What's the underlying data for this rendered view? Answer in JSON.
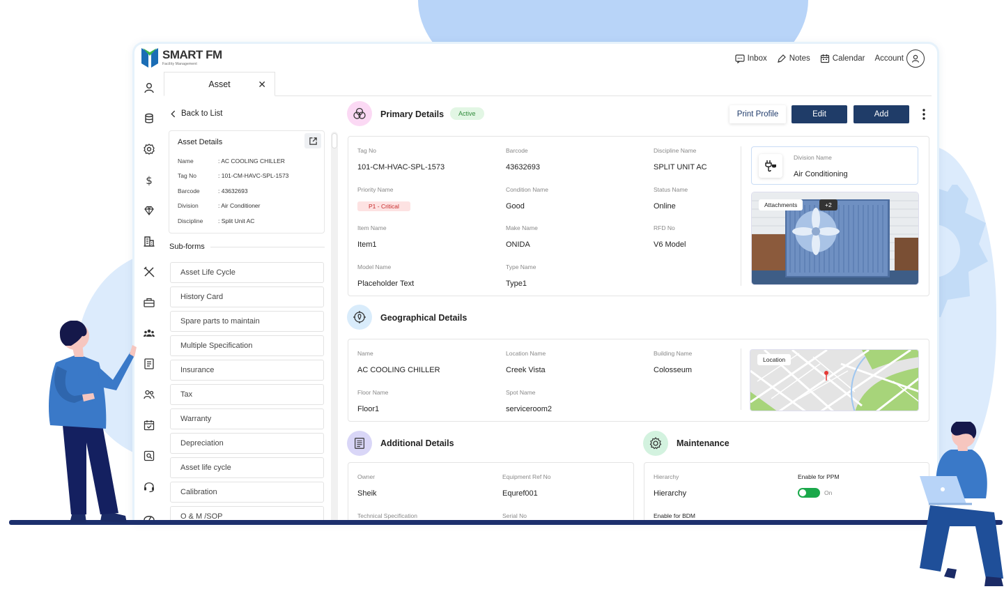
{
  "brand": {
    "name": "SMART FM",
    "tagline": "Facility Management"
  },
  "topnav": {
    "inbox": "Inbox",
    "notes": "Notes",
    "calendar": "Calendar",
    "account": "Account"
  },
  "tab": {
    "label": "Asset",
    "close": "✕"
  },
  "back": "Back to List",
  "asset_details": {
    "title": "Asset Details",
    "rows": [
      {
        "key": "Name",
        "value": ": AC COOLING CHILLER"
      },
      {
        "key": "Tag No",
        "value": ": 101-CM-HAVC-SPL-1573"
      },
      {
        "key": "Barcode",
        "value": ": 43632693"
      },
      {
        "key": "Division",
        "value": ": Air Conditioner"
      },
      {
        "key": "Discipline",
        "value": ": Split Unit AC"
      }
    ]
  },
  "subforms": {
    "title": "Sub-forms",
    "items": [
      "Asset Life Cycle",
      "History Card",
      "Spare parts to maintain",
      "Multiple Specification",
      "Insurance",
      "Tax",
      "Warranty",
      "Depreciation",
      "Asset life cycle",
      "Calibration",
      "O & M /SOP"
    ]
  },
  "primary": {
    "title": "Primary Details",
    "status": "Active",
    "buttons": {
      "print": "Print Profile",
      "edit": "Edit",
      "add": "Add"
    },
    "fields": {
      "tag_no": {
        "label": "Tag No",
        "value": "101-CM-HVAC-SPL-1573"
      },
      "barcode": {
        "label": "Barcode",
        "value": "43632693"
      },
      "discipline": {
        "label": "Discipline Name",
        "value": "SPLIT UNIT AC"
      },
      "priority": {
        "label": "Priority Name",
        "value": "P1 - Critical"
      },
      "condition": {
        "label": "Condition Name",
        "value": "Good"
      },
      "status": {
        "label": "Status Name",
        "value": "Online"
      },
      "item": {
        "label": "Item Name",
        "value": "Item1"
      },
      "make": {
        "label": "Make Name",
        "value": "ONIDA"
      },
      "rfd": {
        "label": "RFD No",
        "value": "V6 Model"
      },
      "model": {
        "label": "Model Name",
        "value": "Placeholder Text"
      },
      "type": {
        "label": "Type Name",
        "value": "Type1"
      }
    },
    "division": {
      "label": "Division Name",
      "value": "Air Conditioning"
    },
    "attachments": {
      "label": "Attachments",
      "more": "+2"
    }
  },
  "geo": {
    "title": "Geographical Details",
    "fields": {
      "name": {
        "label": "Name",
        "value": "AC COOLING CHILLER"
      },
      "location": {
        "label": "Location Name",
        "value": "Creek Vista"
      },
      "building": {
        "label": "Building Name",
        "value": "Colosseum"
      },
      "floor": {
        "label": "Floor Name",
        "value": "Floor1"
      },
      "spot": {
        "label": "Spot Name",
        "value": "serviceroom2"
      }
    },
    "map_label": "Location"
  },
  "additional": {
    "title": "Additional Details",
    "fields": {
      "owner": {
        "label": "Owner",
        "value": "Sheik"
      },
      "equipment_ref": {
        "label": "Equipment Ref No",
        "value": "Equref001"
      },
      "tech_spec": {
        "label": "Technical Specification"
      },
      "serial": {
        "label": "Serial No"
      }
    }
  },
  "maintenance": {
    "title": "Maintenance",
    "fields": {
      "hierarchy": {
        "label": "Hierarchy",
        "value": "Hierarchy"
      },
      "ppm": {
        "label": "Enable for PPM",
        "value": "On"
      },
      "bdm": {
        "label": "Enable for BDM"
      }
    }
  },
  "colors": {
    "primary_button": "#1f3c68",
    "active_green": "#2f8a3a",
    "critical_red": "#c62828",
    "toggle_on": "#1aa84a"
  }
}
